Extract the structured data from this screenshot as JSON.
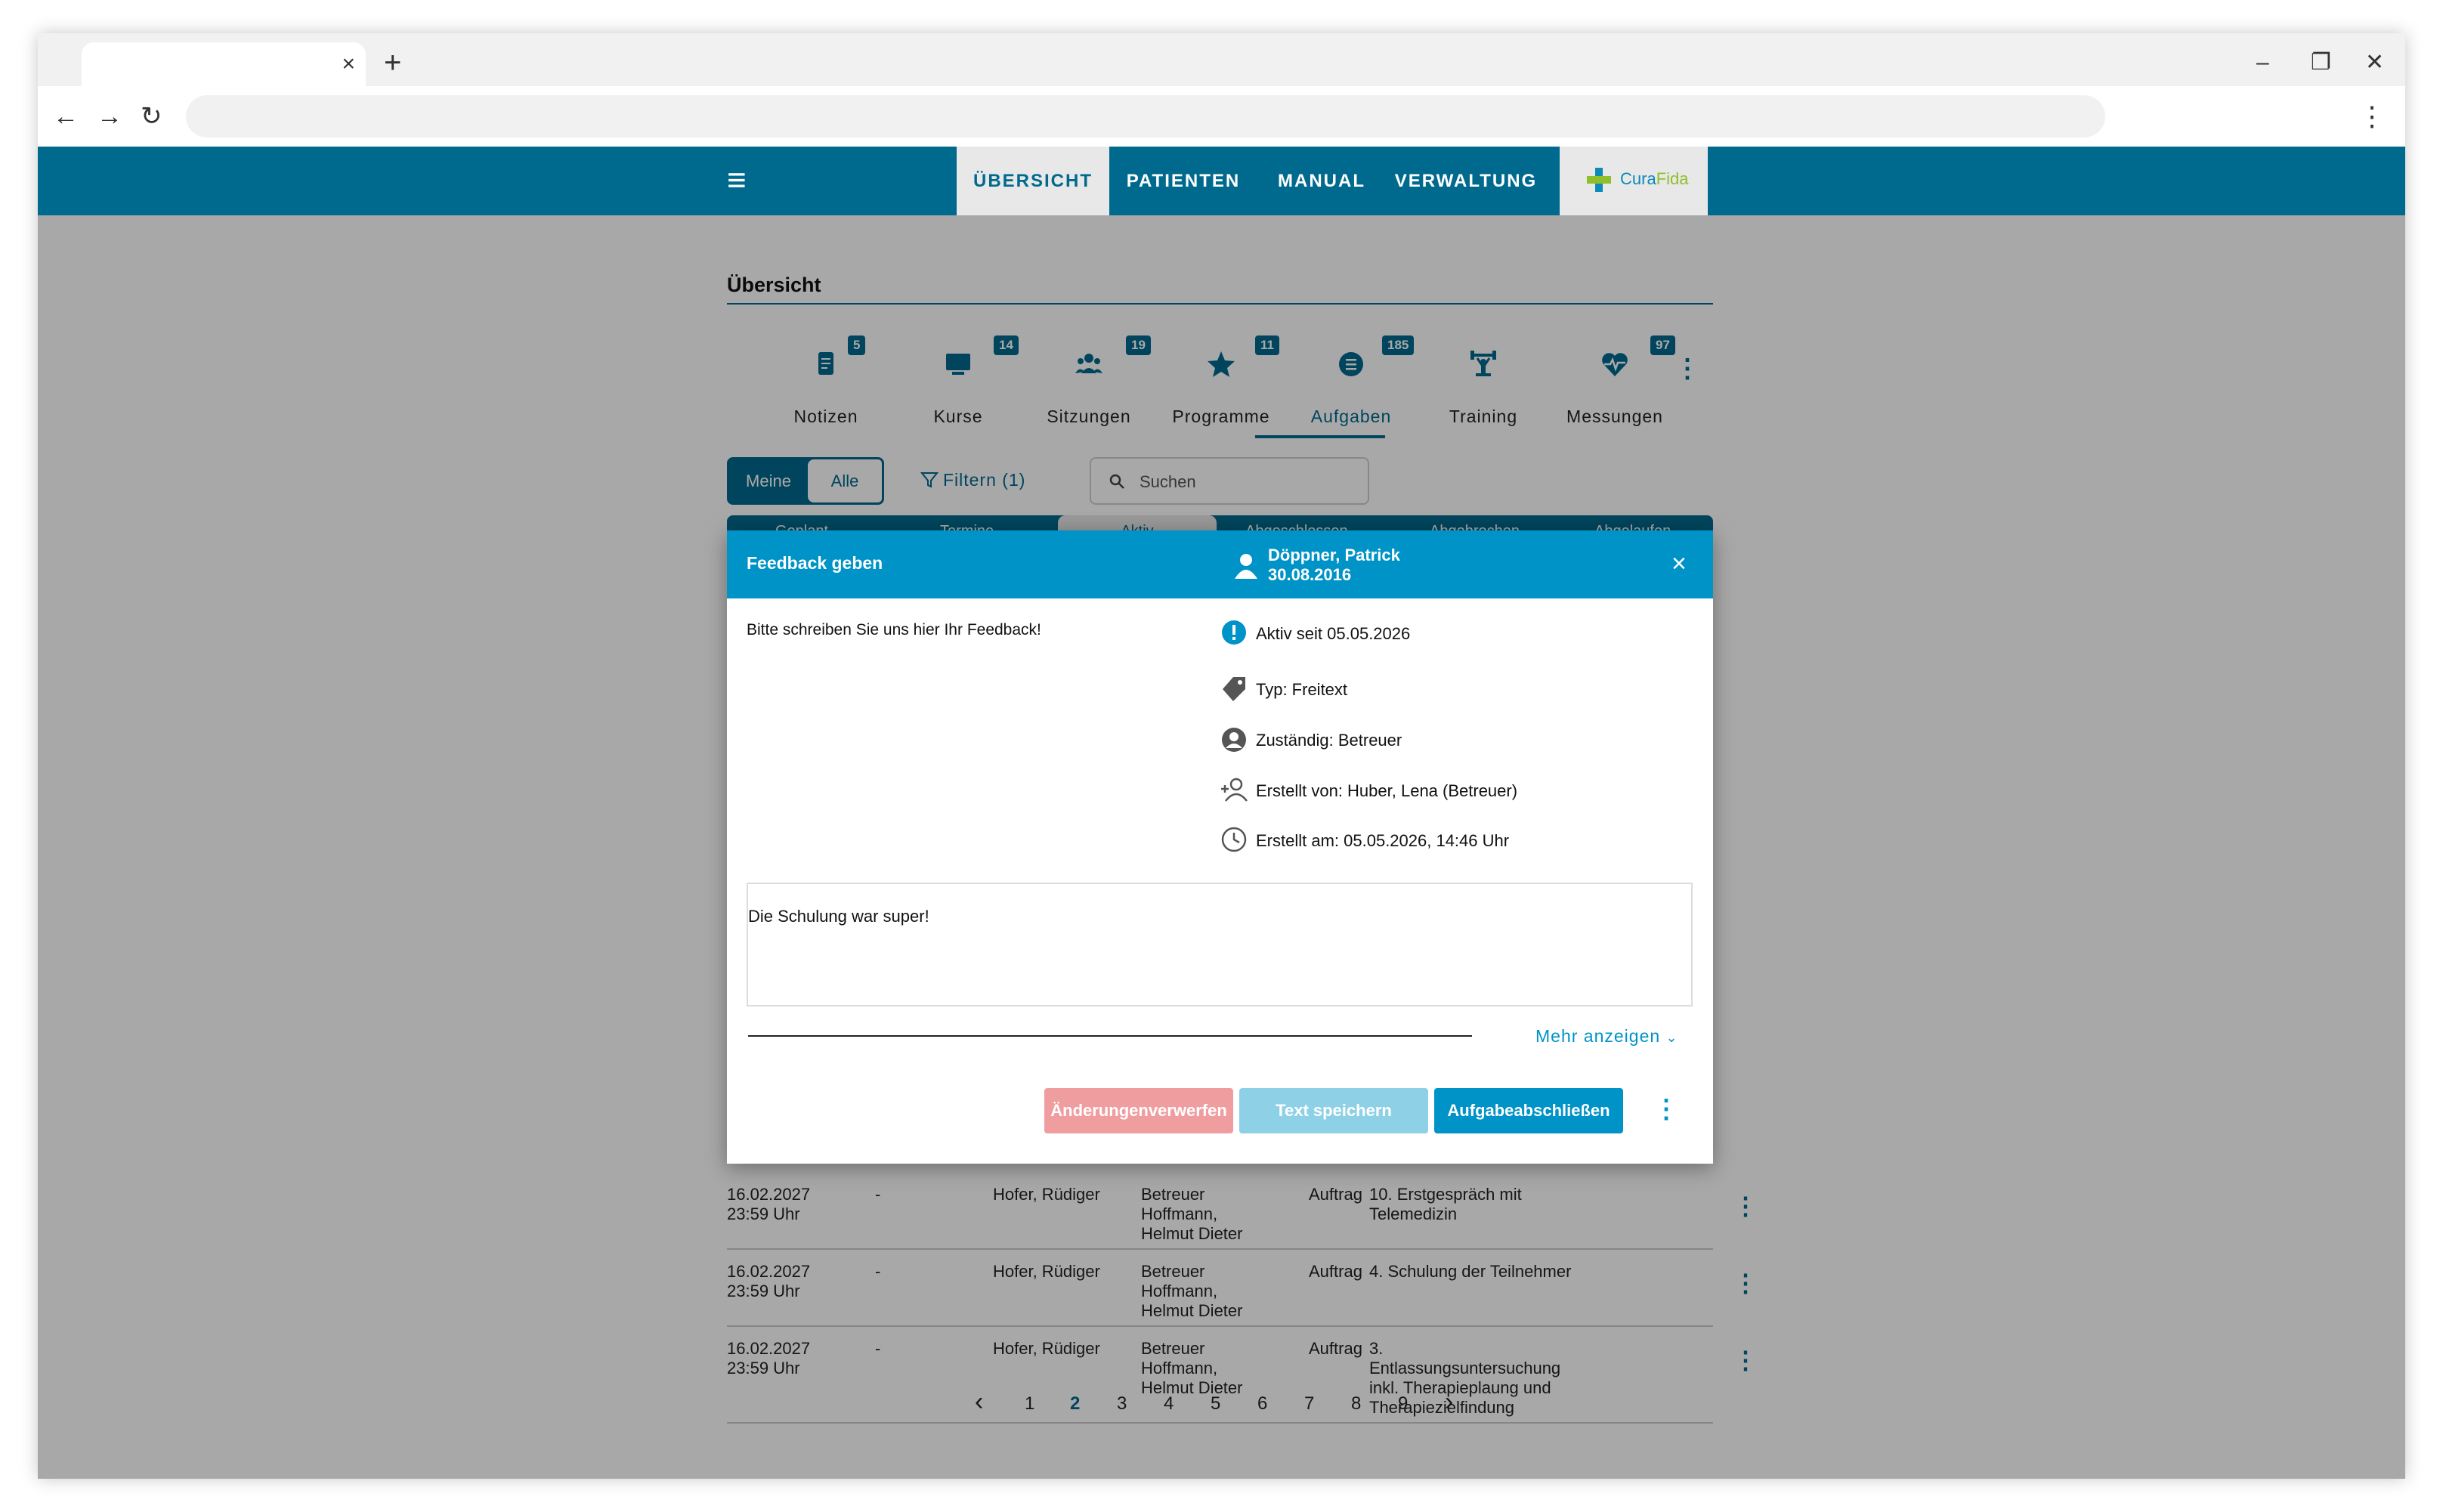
{
  "browser": {
    "tab_close": "×",
    "new_tab": "+",
    "minimize": "–",
    "restore": "❐",
    "close": "✕",
    "back": "←",
    "forward": "→",
    "reload": "↻",
    "menu": "⋮"
  },
  "appbar": {
    "menu_icon": "≡",
    "nav": [
      "ÜBERSICHT",
      "PATIENTEN",
      "MANUAL",
      "VERWALTUNG"
    ],
    "active_nav": "ÜBERSICHT",
    "logo": {
      "part1": "Cura",
      "part2": "Fida"
    },
    "colors": {
      "primary": "#006a8e",
      "accent": "#0093c7",
      "logo_green": "#8fbf2a"
    }
  },
  "page": {
    "title": "Übersicht"
  },
  "categories": [
    {
      "label": "Notizen",
      "badge": "5",
      "icon": "note-icon"
    },
    {
      "label": "Kurse",
      "badge": "14",
      "icon": "monitor-icon"
    },
    {
      "label": "Sitzungen",
      "badge": "19",
      "icon": "group-icon"
    },
    {
      "label": "Programme",
      "badge": "11",
      "icon": "star-icon"
    },
    {
      "label": "Aufgaben",
      "badge": "185",
      "icon": "task-list-icon",
      "active": true
    },
    {
      "label": "Training",
      "badge": "",
      "icon": "weightlifting-icon"
    },
    {
      "label": "Messungen",
      "badge": "97",
      "icon": "heart-pulse-icon"
    }
  ],
  "more_icon": "⋮",
  "toolbar": {
    "seg_meine": "Meine",
    "seg_alle": "Alle",
    "filter_label": "Filtern (1)",
    "search_placeholder": "Suchen"
  },
  "status_tabs": [
    "Geplant",
    "Termine",
    "Aktiv",
    "Abgeschlossen",
    "Abgebrochen",
    "Abgelaufen"
  ],
  "table": {
    "rows": [
      {
        "date": "16.02.2027",
        "time": "23:59 Uhr",
        "dash": "-",
        "patient": "Hofer, Rüdiger",
        "resp1": "Betreuer",
        "resp2": "Hoffmann,",
        "resp3": "Helmut Dieter",
        "type": "Auftrag",
        "task1": "10. Erstgespräch mit",
        "task2": "Telemedizin",
        "task3": "",
        "task4": ""
      },
      {
        "date": "16.02.2027",
        "time": "23:59 Uhr",
        "dash": "-",
        "patient": "Hofer, Rüdiger",
        "resp1": "Betreuer",
        "resp2": "Hoffmann,",
        "resp3": "Helmut Dieter",
        "type": "Auftrag",
        "task1": "4. Schulung der Teilnehmer",
        "task2": "",
        "task3": "",
        "task4": ""
      },
      {
        "date": "16.02.2027",
        "time": "23:59 Uhr",
        "dash": "-",
        "patient": "Hofer, Rüdiger",
        "resp1": "Betreuer",
        "resp2": "Hoffmann,",
        "resp3": "Helmut Dieter",
        "type": "Auftrag",
        "task1": "3.",
        "task2": "Entlassungsuntersuchung",
        "task3": "inkl. Therapieplaung und",
        "task4": "Therapiezielfindung"
      }
    ],
    "row_menu": "⋮"
  },
  "pager": {
    "prev": "‹",
    "next": "›",
    "pages": [
      "1",
      "2",
      "3",
      "4",
      "5",
      "6",
      "7",
      "8",
      "9"
    ],
    "current": "2"
  },
  "dialog": {
    "title": "Feedback geben",
    "patient_name": "Döppner, Patrick",
    "patient_dob": "30.08.2016",
    "close": "×",
    "description": "Bitte schreiben Sie uns hier Ihr Feedback!",
    "meta": {
      "active_since": "Aktiv seit 05.05.2026",
      "type": "Typ: Freitext",
      "responsible": "Zuständig: Betreuer",
      "created_by": "Erstellt von: Huber, Lena (Betreuer)",
      "created_at": "Erstellt am: 05.05.2026, 14:46 Uhr"
    },
    "answer": "Die Schulung war super!",
    "show_more": "Mehr anzeigen",
    "btn_discard_1": "Änderungen",
    "btn_discard_2": "verwerfen",
    "btn_save": "Text speichern",
    "btn_done_1": "Aufgabe",
    "btn_done_2": "abschließen",
    "more": "⋮",
    "colors": {
      "discard": "#ef9d9f",
      "save": "#8ed1e7",
      "done": "#0093c7"
    }
  }
}
